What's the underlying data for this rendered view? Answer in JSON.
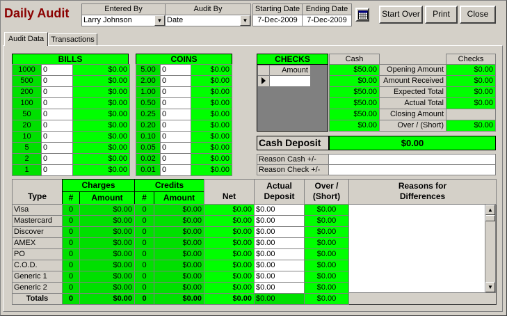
{
  "title": "Daily Audit",
  "header": {
    "entered_by_label": "Entered By",
    "entered_by_value": "Larry Johnson",
    "audit_by_label": "Audit By",
    "audit_by_value": "Date",
    "starting_date_label": "Starting Date",
    "starting_date_value": "7-Dec-2009",
    "ending_date_label": "Ending Date",
    "ending_date_value": "7-Dec-2009"
  },
  "buttons": {
    "start_over": "Start Over",
    "print": "Print",
    "close": "Close"
  },
  "tabs": [
    "Audit Data",
    "Transactions"
  ],
  "bills": {
    "header": "BILLS",
    "rows": [
      {
        "denom": "1000",
        "qty": "0",
        "amount": "$0.00"
      },
      {
        "denom": "500",
        "qty": "0",
        "amount": "$0.00"
      },
      {
        "denom": "200",
        "qty": "0",
        "amount": "$0.00"
      },
      {
        "denom": "100",
        "qty": "0",
        "amount": "$0.00"
      },
      {
        "denom": "50",
        "qty": "0",
        "amount": "$0.00"
      },
      {
        "denom": "20",
        "qty": "0",
        "amount": "$0.00"
      },
      {
        "denom": "10",
        "qty": "0",
        "amount": "$0.00"
      },
      {
        "denom": "5",
        "qty": "0",
        "amount": "$0.00"
      },
      {
        "denom": "2",
        "qty": "0",
        "amount": "$0.00"
      },
      {
        "denom": "1",
        "qty": "0",
        "amount": "$0.00"
      }
    ]
  },
  "coins": {
    "header": "COINS",
    "rows": [
      {
        "denom": "5.00",
        "qty": "0",
        "amount": "$0.00"
      },
      {
        "denom": "2.00",
        "qty": "0",
        "amount": "$0.00"
      },
      {
        "denom": "1.00",
        "qty": "0",
        "amount": "$0.00"
      },
      {
        "denom": "0.50",
        "qty": "0",
        "amount": "$0.00"
      },
      {
        "denom": "0.25",
        "qty": "0",
        "amount": "$0.00"
      },
      {
        "denom": "0.20",
        "qty": "0",
        "amount": "$0.00"
      },
      {
        "denom": "0.10",
        "qty": "0",
        "amount": "$0.00"
      },
      {
        "denom": "0.05",
        "qty": "0",
        "amount": "$0.00"
      },
      {
        "denom": "0.02",
        "qty": "0",
        "amount": "$0.00"
      },
      {
        "denom": "0.01",
        "qty": "0",
        "amount": "$0.00"
      }
    ]
  },
  "checks": {
    "header": "CHECKS",
    "amount_label": "Amount"
  },
  "summary": {
    "cash_label": "Cash",
    "checks_label": "Checks",
    "rows": [
      {
        "label": "Opening Amount",
        "cash": "$50.00",
        "checks": "$0.00"
      },
      {
        "label": "Amount Received",
        "cash": "$0.00",
        "checks": "$0.00"
      },
      {
        "label": "Expected Total",
        "cash": "$50.00",
        "checks": "$0.00"
      },
      {
        "label": "Actual Total",
        "cash": "$50.00",
        "checks": "$0.00"
      },
      {
        "label": "Closing Amount",
        "cash": "$50.00",
        "checks": ""
      },
      {
        "label": "Over / (Short)",
        "cash": "$0.00",
        "checks": "$0.00"
      }
    ]
  },
  "cash_deposit": {
    "label": "Cash Deposit",
    "value": "$0.00"
  },
  "reasons": {
    "cash_label": "Reason Cash +/-",
    "check_label": "Reason Check +/-"
  },
  "grid": {
    "type_label": "Type",
    "charges_label": "Charges",
    "credits_label": "Credits",
    "num_label": "#",
    "amount_label": "Amount",
    "net_label": "Net",
    "actual_deposit_label": "Actual Deposit",
    "over_short_label": "Over / (Short)",
    "reasons_label": "Reasons for Differences",
    "rows": [
      {
        "type": "Visa",
        "ch_n": "0",
        "ch_amt": "$0.00",
        "cr_n": "0",
        "cr_amt": "$0.00",
        "net": "$0.00",
        "actual": "$0.00",
        "over": "$0.00"
      },
      {
        "type": "Mastercard",
        "ch_n": "0",
        "ch_amt": "$0.00",
        "cr_n": "0",
        "cr_amt": "$0.00",
        "net": "$0.00",
        "actual": "$0.00",
        "over": "$0.00"
      },
      {
        "type": "Discover",
        "ch_n": "0",
        "ch_amt": "$0.00",
        "cr_n": "0",
        "cr_amt": "$0.00",
        "net": "$0.00",
        "actual": "$0.00",
        "over": "$0.00"
      },
      {
        "type": "AMEX",
        "ch_n": "0",
        "ch_amt": "$0.00",
        "cr_n": "0",
        "cr_amt": "$0.00",
        "net": "$0.00",
        "actual": "$0.00",
        "over": "$0.00"
      },
      {
        "type": "PO",
        "ch_n": "0",
        "ch_amt": "$0.00",
        "cr_n": "0",
        "cr_amt": "$0.00",
        "net": "$0.00",
        "actual": "$0.00",
        "over": "$0.00"
      },
      {
        "type": "C.O.D.",
        "ch_n": "0",
        "ch_amt": "$0.00",
        "cr_n": "0",
        "cr_amt": "$0.00",
        "net": "$0.00",
        "actual": "$0.00",
        "over": "$0.00"
      },
      {
        "type": "Generic 1",
        "ch_n": "0",
        "ch_amt": "$0.00",
        "cr_n": "0",
        "cr_amt": "$0.00",
        "net": "$0.00",
        "actual": "$0.00",
        "over": "$0.00"
      },
      {
        "type": "Generic 2",
        "ch_n": "0",
        "ch_amt": "$0.00",
        "cr_n": "0",
        "cr_amt": "$0.00",
        "net": "$0.00",
        "actual": "$0.00",
        "over": "$0.00"
      }
    ],
    "totals": {
      "type": "Totals",
      "ch_n": "0",
      "ch_amt": "$0.00",
      "cr_n": "0",
      "cr_amt": "$0.00",
      "net": "$0.00",
      "actual": "$0.00",
      "over": "$0.00"
    }
  },
  "icons": {
    "calendar": "calendar-icon",
    "dropdown": "chevron-down-icon",
    "record": "record-pointer-icon"
  }
}
